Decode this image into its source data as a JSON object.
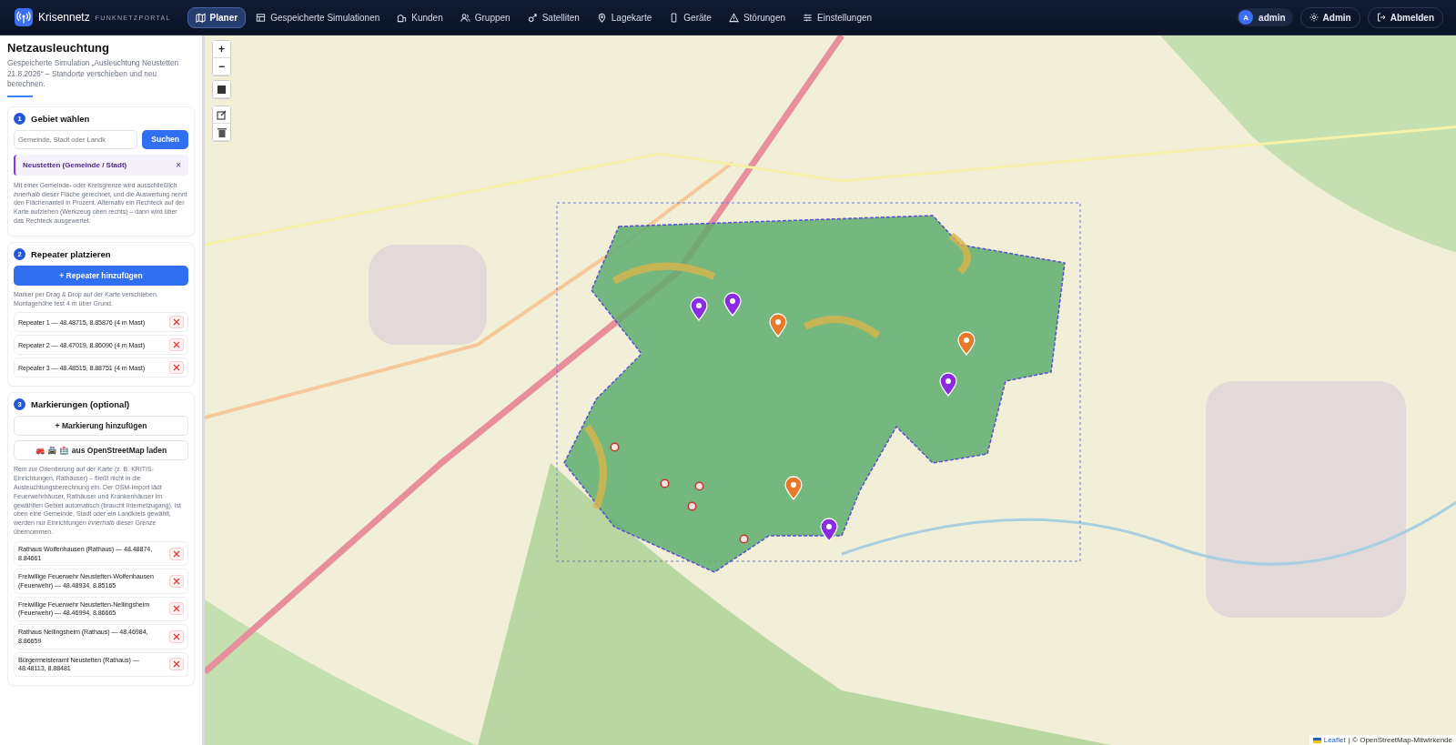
{
  "app": {
    "name": "Krisennetz",
    "subtitle": "FUNKNETZPORTAL"
  },
  "nav": [
    {
      "label": "Planer",
      "selected": true
    },
    {
      "label": "Gespeicherte Simulationen",
      "selected": false
    },
    {
      "label": "Kunden",
      "selected": false
    },
    {
      "label": "Gruppen",
      "selected": false
    },
    {
      "label": "Satelliten",
      "selected": false
    },
    {
      "label": "Lagekarte",
      "selected": false
    },
    {
      "label": "Geräte",
      "selected": false
    },
    {
      "label": "Störungen",
      "selected": false
    },
    {
      "label": "Einstellungen",
      "selected": false
    }
  ],
  "user": {
    "initial": "A",
    "name": "admin"
  },
  "header_buttons": [
    "Admin",
    "Abmelden"
  ],
  "sidebar": {
    "title": "Netzausleuchtung",
    "subtitle": "Gespeicherte Simulation „Ausleuchtung Neustetten 21.8.2026“ – Standorte verschieben und neu berechnen.",
    "steps": [
      {
        "number": "1",
        "title": "Gebiet wählen",
        "kind": "area",
        "search": {
          "placeholder": "Gemeinde, Stadt oder Landk",
          "button": "Suchen"
        },
        "chip": {
          "label": "Neustetten (Gemeinde / Stadt)",
          "remove": "×"
        },
        "note": "Mit einer Gemeinde- oder Kreisgrenze wird ausschließlich *innerhalb* dieser Fläche gerechnet, und die Auswertung nennt den Flächenanteil in Prozent. Alternativ ein Rechteck auf der Karte aufziehen (Werkzeug oben rechts) – dann wird über das Rechteck ausgewertet."
      },
      {
        "number": "2",
        "title": "Repeater platzieren",
        "kind": "repeaters",
        "primary_button": "+ Repeater hinzufügen",
        "note": "Marker per Drag & Drop auf der Karte verschieben. Montagehöhe fest 4 m über Grund.",
        "items": [
          "Repeater 1 — 48.48715, 8.85876 (4 m Mast)",
          "Repeater 2 — 48.47019, 8.86090 (4 m Mast)",
          "Repeater 3 — 48.48515, 8.88751 (4 m Mast)"
        ]
      },
      {
        "number": "3",
        "title": "Markierungen (optional)",
        "kind": "markers",
        "secondary_buttons": [
          "+ Markierung hinzufügen",
          "🚒 🚔 🏥 aus OpenStreetMap laden"
        ],
        "note": "Rein zur Orientierung auf der Karte (z. B. KRITIS-Einrichtungen, Rathäuser) – fließt nicht in die Ausleuchtungsberechnung ein. Der OSM-Import lädt Feuerwehrhäuser, Rathäuser und Krankenhäuser im gewählten Gebiet automatisch (braucht Internetzugang). Ist oben eine Gemeinde, Stadt oder ein Landkreis gewählt, werden nur Einrichtungen *innerhalb* dieser Grenze übernommen.",
        "items": [
          "Rathaus Wolfenhausen (Rathaus) — 48.48874, 8.84661",
          "Freiwillige Feuerwehr Neustetten-Wolfenhausen (Feuerwehr) — 48.48934, 8.85165",
          "Freiwillige Feuerwehr Neustetten-Nellingsheim (Feuerwehr) — 48.46994, 8.86665",
          "Rathaus Nellingsheim (Rathaus) — 48.46984, 8.86659",
          "Bürgermeisteramt Neustetten (Rathaus) — 48.48113, 8.88481"
        ]
      }
    ]
  },
  "map": {
    "controls": [
      "+",
      "−"
    ],
    "markers": [
      {
        "kind": "repeater"
      },
      {
        "kind": "repeater"
      },
      {
        "kind": "repeater"
      },
      {
        "kind": "repeater"
      },
      {
        "kind": "device"
      },
      {
        "kind": "device"
      },
      {
        "kind": "device"
      },
      {
        "kind": "poi"
      },
      {
        "kind": "poi"
      },
      {
        "kind": "poi"
      },
      {
        "kind": "poi"
      },
      {
        "kind": "poi"
      }
    ],
    "attribution": {
      "link": "Leaflet",
      "text": "| © OpenStreetMap-Mitwirkende"
    }
  }
}
